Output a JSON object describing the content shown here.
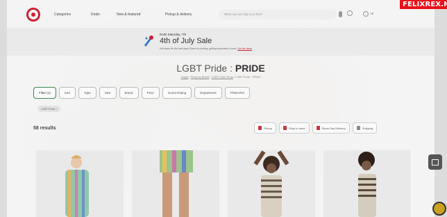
{
  "header": {
    "nav": [
      "Categories",
      "Deals",
      "New & featured",
      "Pickup & delivery"
    ],
    "search_placeholder": "What can we help you find?",
    "account_label": "Hi",
    "watermark": "FELIXREX.NET"
  },
  "promo": {
    "kicker": "Ends Saturday, 7/6",
    "title": "4th of July Sale",
    "subtitle": "Hot deals for the best days! Save on clothing, grilling essentials & more.",
    "link": "Get the deals"
  },
  "page": {
    "title_prefix": "LGBT Pride : ",
    "title_bold": "PRIDE",
    "breadcrumb": [
      "Target",
      "Shop by Brand",
      "LGBT Pride Shop",
      "LGBT Pride : PRIDE"
    ]
  },
  "filters": [
    "Filter (1)",
    "Sort",
    "Type",
    "Size",
    "Brand",
    "Price",
    "Guest Rating",
    "Department",
    "PRIDARO"
  ],
  "active_tag": "LGBT Pride ×",
  "results": "58 results",
  "fulfillment": [
    "Pickup",
    "Shop in store",
    "Same Day Delivery",
    "Shipping"
  ],
  "colors": {
    "brand": "#cc2233",
    "active_filter": "#3a8a50",
    "watermark_bg": "#e8111a"
  }
}
